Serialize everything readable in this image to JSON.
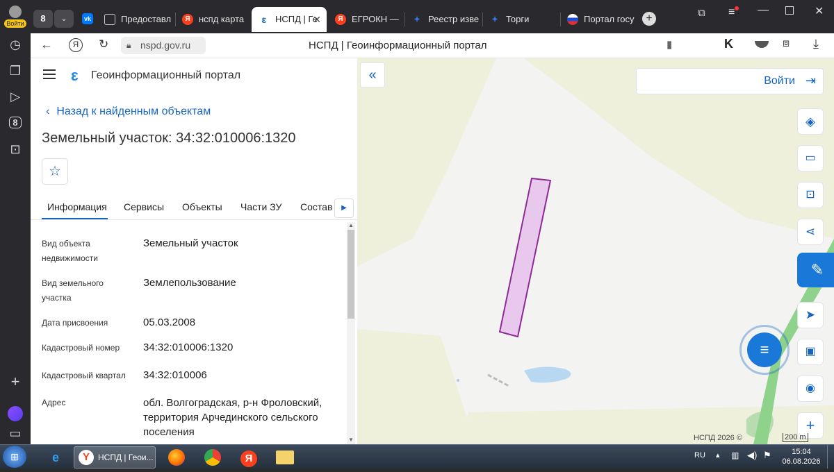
{
  "yandex_sidebar": {
    "login_label": "Войти",
    "badge": "8"
  },
  "tabs": [
    {
      "label": "Предоставл",
      "favicon": "page-icon"
    },
    {
      "label": "нспд карта",
      "favicon": "yandex-icon"
    },
    {
      "label": "НСПД | Ге",
      "favicon": "nspd-icon",
      "active": true
    },
    {
      "label": "ЕГРОКН — ",
      "favicon": "yandex-icon"
    },
    {
      "label": "Реестр изве",
      "favicon": "emblem-icon"
    },
    {
      "label": "Торги",
      "favicon": "emblem-icon"
    },
    {
      "label": "Портал госу",
      "favicon": "flag-icon"
    }
  ],
  "tab_count_badge": "8",
  "address": {
    "url": "nspd.gov.ru",
    "page_title": "НСПД | Геоинформационный портал"
  },
  "panel": {
    "app_title": "Геоинформационный портал",
    "back_link": "Назад к найденным объектам",
    "object_title": "Земельный участок: 34:32:010006:1320",
    "tabs": [
      "Информация",
      "Сервисы",
      "Объекты",
      "Части ЗУ",
      "Состав"
    ],
    "active_tab": "Информация",
    "rows": [
      {
        "label": "Вид объекта недвижимости",
        "value": "Земельный участок"
      },
      {
        "label": "Вид земельного участка",
        "value": "Землепользование"
      },
      {
        "label": "Дата присвоения",
        "value": "05.03.2008"
      },
      {
        "label": "Кадастровый номер",
        "value": "34:32:010006:1320"
      },
      {
        "label": "Кадастровый квартал",
        "value": "34:32:010006"
      },
      {
        "label": "Адрес",
        "value": "обл. Волгоградская, р-н Фроловский, территория Арчединского сельского поселения"
      }
    ]
  },
  "map": {
    "login_button": "Войти",
    "copyright": "НСПД 2026 ©",
    "scale": "200 m",
    "parcel_color": "#e8c8ec",
    "parcel_stroke": "#8e2a96"
  },
  "taskbar": {
    "window_label": "НСПД | Геои...",
    "lang": "RU",
    "time": "15:04",
    "date": "06.08.2026"
  },
  "colors": {
    "accent": "#1565c0",
    "browser_dark": "#2a2a2e"
  }
}
